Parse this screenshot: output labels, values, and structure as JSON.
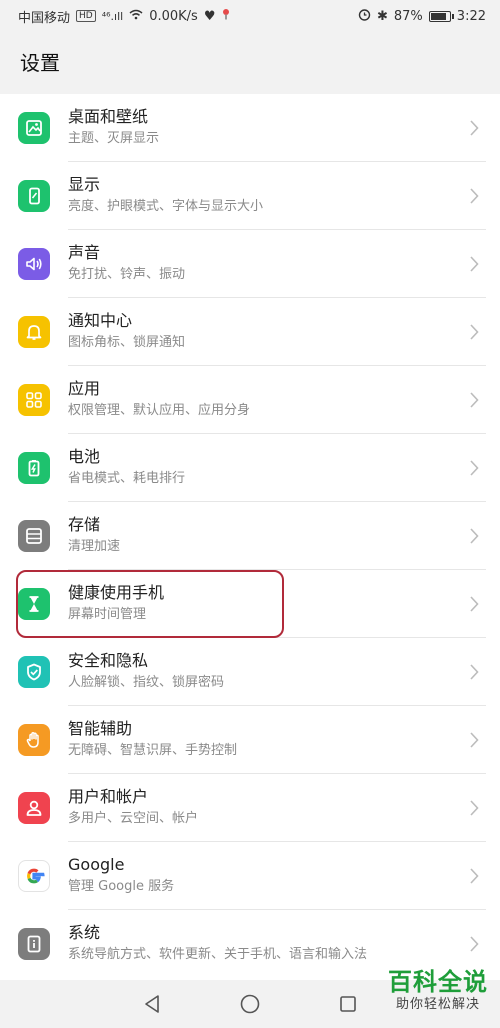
{
  "statusbar": {
    "carrier": "中国移动",
    "hd": "HD",
    "signal": "⁴⁶.ıll",
    "speed": "0.00K/s",
    "battery_text": "87%",
    "battery_level": 0.87,
    "time": "3:22"
  },
  "header": {
    "title": "设置"
  },
  "items": [
    {
      "title": "桌面和壁纸",
      "subtitle": "主题、灭屏显示",
      "icon": "wallpaper-icon",
      "color": "#1ec26e"
    },
    {
      "title": "显示",
      "subtitle": "亮度、护眼模式、字体与显示大小",
      "icon": "display-icon",
      "color": "#1ec26e"
    },
    {
      "title": "声音",
      "subtitle": "免打扰、铃声、振动",
      "icon": "sound-icon",
      "color": "#7b5ce6"
    },
    {
      "title": "通知中心",
      "subtitle": "图标角标、锁屏通知",
      "icon": "bell-icon",
      "color": "#f6c200"
    },
    {
      "title": "应用",
      "subtitle": "权限管理、默认应用、应用分身",
      "icon": "apps-icon",
      "color": "#f6c200"
    },
    {
      "title": "电池",
      "subtitle": "省电模式、耗电排行",
      "icon": "battery-icon",
      "color": "#1ec26e"
    },
    {
      "title": "存储",
      "subtitle": "清理加速",
      "icon": "storage-icon",
      "color": "#7d7d7d"
    },
    {
      "title": "健康使用手机",
      "subtitle": "屏幕时间管理",
      "icon": "hourglass-icon",
      "color": "#1ec26e"
    },
    {
      "title": "安全和隐私",
      "subtitle": "人脸解锁、指纹、锁屏密码",
      "icon": "shield-icon",
      "color": "#20c2b5"
    },
    {
      "title": "智能辅助",
      "subtitle": "无障碍、智慧识屏、手势控制",
      "icon": "hand-icon",
      "color": "#f59a23"
    },
    {
      "title": "用户和帐户",
      "subtitle": "多用户、云空间、帐户",
      "icon": "user-icon",
      "color": "#f0434f"
    },
    {
      "title": "Google",
      "subtitle": "管理 Google 服务",
      "icon": "google-icon",
      "color": "#ffffff"
    },
    {
      "title": "系统",
      "subtitle": "系统导航方式、软件更新、关于手机、语言和输入法",
      "icon": "system-icon",
      "color": "#7d7d7d"
    }
  ],
  "watermark": {
    "title": "百科全说",
    "subtitle": "助你轻松解决"
  }
}
